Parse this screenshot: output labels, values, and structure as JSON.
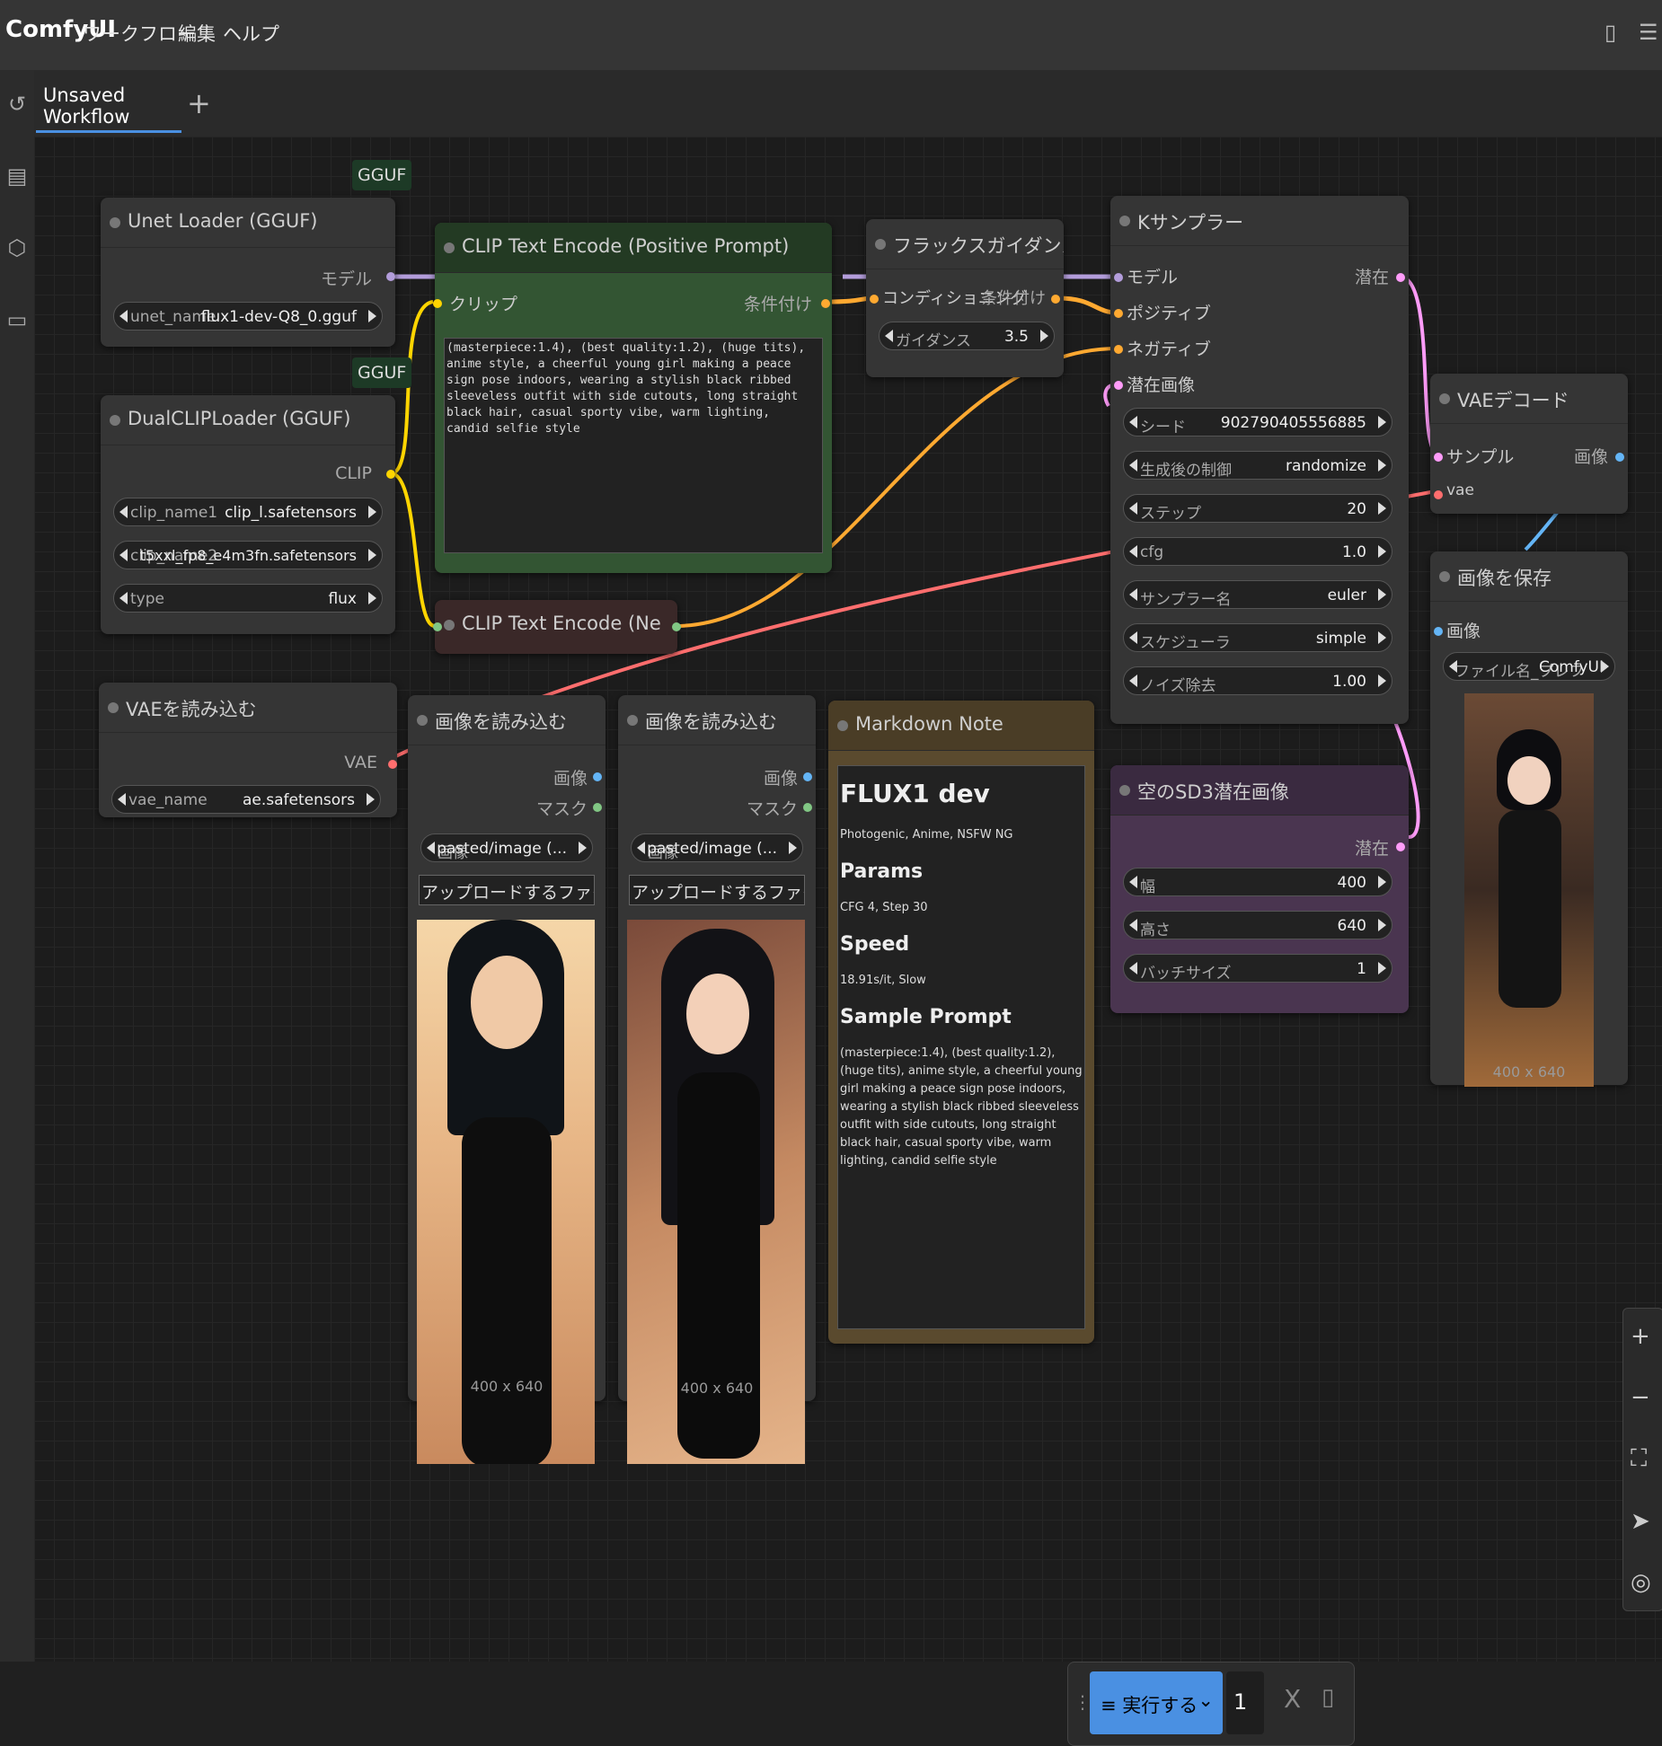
{
  "app": {
    "logo": "ComfyUI"
  },
  "menu": [
    "ワークフロー",
    "編集",
    "ヘルプ"
  ],
  "tabs": {
    "active": "Unsaved Workflow",
    "add": "+"
  },
  "colors": {
    "accent": "#4a90e2",
    "model": "#b39ddb",
    "clip": "#ffd500",
    "conditioning": "#ffa931",
    "vae": "#ff6e6e",
    "image": "#64b5f6",
    "latent": "#ff9cf9",
    "mask": "#81c784"
  },
  "nodes": {
    "unet": {
      "badge": "GGUF",
      "title": "Unet Loader (GGUF)",
      "out": "モデル",
      "widget_label": "unet_name",
      "widget_value": "flux1-dev-Q8_0.gguf"
    },
    "dualclip": {
      "badge": "GGUF",
      "title": "DualCLIPLoader (GGUF)",
      "out": "CLIP",
      "w1_label": "clip_name1",
      "w1_value": "clip_l.safetensors",
      "w2_label": "clip_name2",
      "w2_value": "t5xxl_fp8_e4m3fn.safetensors",
      "w3_label": "type",
      "w3_value": "flux"
    },
    "clip_pos": {
      "title": "CLIP Text Encode (Positive Prompt)",
      "in": "クリップ",
      "out": "条件付け",
      "text": "(masterpiece:1.4), (best quality:1.2), (huge tits), anime style, a cheerful young girl making a peace sign pose indoors, wearing a stylish black ribbed sleeveless outfit with side cutouts, long straight black hair, casual sporty vibe, warm lighting, candid selfie style"
    },
    "clip_neg": {
      "title": "CLIP Text Encode (Ne"
    },
    "flux_guid": {
      "title": "フラックスガイダンス",
      "in": "コンディショニング",
      "out": "条件付け",
      "widget_label": "ガイダンス",
      "widget_value": "3.5"
    },
    "ksampler": {
      "title": "Kサンプラー",
      "in_model": "モデル",
      "in_pos": "ポジティブ",
      "in_neg": "ネガティブ",
      "in_latent": "潜在画像",
      "out": "潜在",
      "seed_label": "シード",
      "seed_value": "902790405556885",
      "ctrl_label": "生成後の制御",
      "ctrl_value": "randomize",
      "steps_label": "ステップ",
      "steps_value": "20",
      "cfg_label": "cfg",
      "cfg_value": "1.0",
      "sampler_label": "サンプラー名",
      "sampler_value": "euler",
      "sched_label": "スケジューラ",
      "sched_value": "simple",
      "denoise_label": "ノイズ除去",
      "denoise_value": "1.00"
    },
    "vae_decode": {
      "title": "VAEデコード",
      "in_samples": "サンプル",
      "in_vae": "vae",
      "out": "画像"
    },
    "save_image": {
      "title": "画像を保存",
      "in": "画像",
      "prefix_label": "ファイル名_プレフ",
      "prefix_value": "ComfyUI",
      "caption": "400 x 640"
    },
    "vae_load": {
      "title": "VAEを読み込む",
      "out": "VAE",
      "widget_label": "vae_name",
      "widget_value": "ae.safetensors"
    },
    "load1": {
      "title": "画像を読み込む",
      "out_image": "画像",
      "out_mask": "マスク",
      "widget_label": "画像",
      "widget_value": "pasted/image (...",
      "upload": "アップロードするファイルを選択",
      "caption": "400 x 640"
    },
    "load2": {
      "title": "画像を読み込む",
      "out_image": "画像",
      "out_mask": "マスク",
      "widget_label": "画像",
      "widget_value": "pasted/image (...",
      "upload": "アップロードするファイルを選択",
      "caption": "400 x 640"
    },
    "latent": {
      "title": "空のSD3潜在画像",
      "out": "潜在",
      "w_label": "幅",
      "w_value": "400",
      "h_label": "高さ",
      "h_value": "640",
      "b_label": "バッチサイズ",
      "b_value": "1"
    },
    "markdown": {
      "title": "Markdown Note",
      "h1": "FLUX1 dev",
      "p1": "Photogenic, Anime, NSFW NG",
      "h2a": "Params",
      "p2": "CFG 4, Step 30",
      "h2b": "Speed",
      "p3": "18.91s/it, Slow",
      "h2c": "Sample Prompt",
      "p4": "(masterpiece:1.4), (best quality:1.2), (huge tits), anime style, a cheerful young girl making a peace sign pose indoors, wearing a stylish black ribbed sleeveless outfit with side cutouts, long straight black hair, casual sporty vibe, warm lighting, candid selfie style"
    }
  },
  "runbar": {
    "run_label": "実行する",
    "count": "1",
    "close": "X"
  },
  "icons": {
    "history": "history-icon",
    "queue": "queue-icon",
    "models": "cube-icon",
    "workflows": "folder-icon",
    "zoom_in": "plus-icon",
    "zoom_out": "minus-icon",
    "fit": "fit-view-icon",
    "select": "pointer-icon",
    "focus": "focus-icon"
  }
}
